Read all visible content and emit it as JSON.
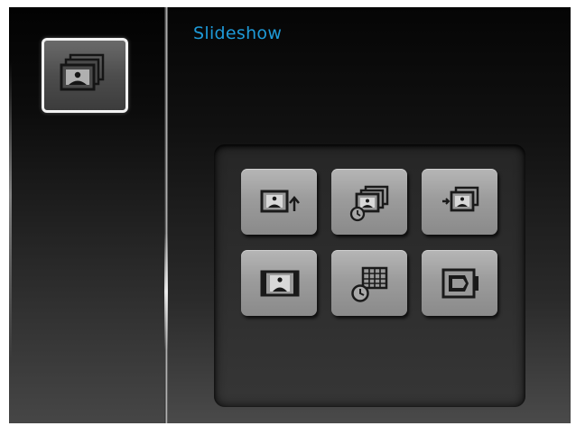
{
  "header": {
    "title": "Slideshow"
  },
  "sidebar": {
    "selected_category_icon": "photo-stack-icon"
  },
  "menu": {
    "options": [
      {
        "icon": "photo-export-icon"
      },
      {
        "icon": "slideshow-timer-icon"
      },
      {
        "icon": "photo-transition-icon"
      },
      {
        "icon": "photo-frame-icon"
      },
      {
        "icon": "calendar-clock-icon"
      },
      {
        "icon": "photo-fit-icon"
      }
    ]
  },
  "colors": {
    "title_accent": "#1e9ad8",
    "background_top": "#050505",
    "background_bottom": "#4a4a4a",
    "tile_fill": "#9c9c9c",
    "selection_border": "#f2f2f2"
  }
}
